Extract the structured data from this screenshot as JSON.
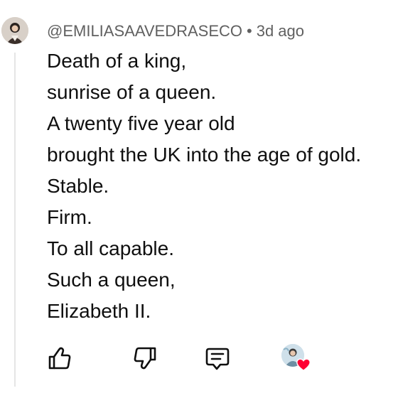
{
  "comment": {
    "author": "@EMILIASAAVEDRASECO",
    "separator": "•",
    "time": "3d ago",
    "lines": [
      "Death of a king,",
      "sunrise of a queen.",
      "A twenty five year old",
      "brought the UK into the age of gold.",
      "Stable.",
      "Firm.",
      "To all capable.",
      "Such a queen,",
      "Elizabeth II."
    ]
  },
  "icons": {
    "like": "thumb-up-icon",
    "dislike": "thumb-down-icon",
    "reply": "reply-comment-icon",
    "hearted": "creator-heart-icon"
  },
  "colors": {
    "heart": "#ff0033",
    "meta_text": "#606060",
    "body_text": "#0f0f0f"
  }
}
